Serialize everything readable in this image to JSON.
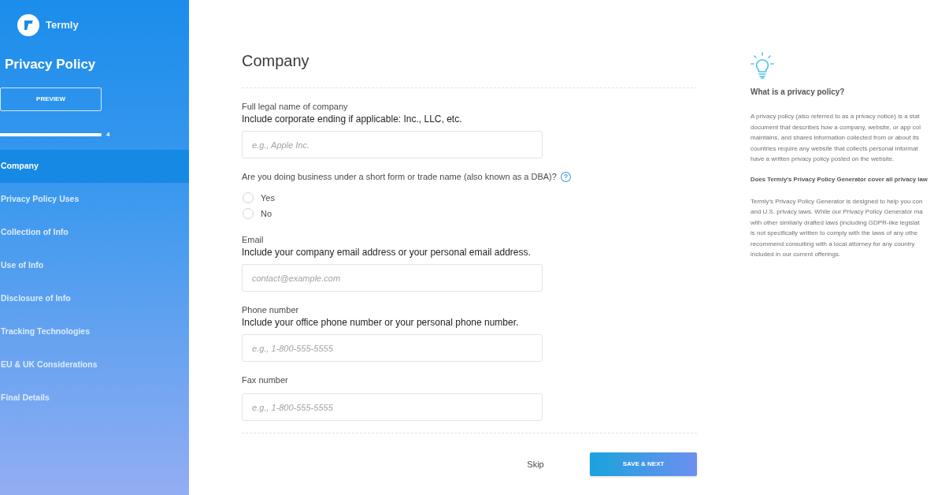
{
  "sidebar": {
    "brand": "Termly",
    "title": "Privacy Policy",
    "preview_button": "PREVIEW",
    "progress": {
      "level": 1,
      "reading": "4"
    },
    "items": [
      {
        "label": "Company",
        "selected": true
      },
      {
        "label": "Privacy Policy Uses",
        "selected": false
      },
      {
        "label": "Collection of Info",
        "selected": false
      },
      {
        "label": "Use of Info",
        "selected": false
      },
      {
        "label": "Disclosure of Info",
        "selected": false
      },
      {
        "label": "Tracking Technologies",
        "selected": false
      },
      {
        "label": "EU & UK Considerations",
        "selected": false
      },
      {
        "label": "Final Details",
        "selected": false
      }
    ]
  },
  "form": {
    "heading": "Company",
    "sections": [
      {
        "kind": "text_field",
        "label": "Full legal name of company",
        "hint": "Include corporate ending if applicable: Inc., LLC, etc.",
        "placeholder": "e.g., Apple Inc."
      },
      {
        "kind": "radio",
        "question": "Are you doing business under a short form or trade name (also known as a DBA)?",
        "options": [
          {
            "label": "Yes",
            "selected": false
          },
          {
            "label": "No",
            "selected": false
          }
        ]
      },
      {
        "kind": "text_field",
        "label": "Email",
        "hint": "Include your company email address or your personal email address.",
        "placeholder": "contact@example.com"
      },
      {
        "kind": "text_field",
        "label": "Phone number",
        "hint": "Include your office phone number or your personal phone number.",
        "placeholder": "e.g., 1-800-555-5555"
      },
      {
        "kind": "text_field",
        "label": "Fax number",
        "placeholder": "e.g., 1-800-555-5555"
      }
    ],
    "actions": {
      "skip": "Skip",
      "save": "SAVE & NEXT"
    }
  },
  "help_panel": {
    "title": "What is a privacy policy?",
    "blocks": [
      {
        "kind": "paragraph",
        "lines": [
          "A privacy policy (also referred to as a privacy notice) is a stat",
          "document that describes how a company, website, or app col",
          "maintains, and shares information collected from or about its",
          "countries require any website that collects personal informat",
          "have a written privacy policy posted on the website."
        ]
      },
      {
        "kind": "heading",
        "lines": [
          "Does Termly's Privacy Policy Generator cover all privacy law"
        ]
      },
      {
        "kind": "paragraph",
        "lines": [
          "Termly's Privacy Policy Generator is designed to help you con",
          "and U.S. privacy laws. While our Privacy Policy Generator ma",
          "with other similarly drafted laws (including GDPR-like legislat",
          "is not specifically written to comply with the laws of any othe",
          "recommend consulting with a local attorney for any country",
          "included in our current offerings."
        ]
      }
    ]
  }
}
